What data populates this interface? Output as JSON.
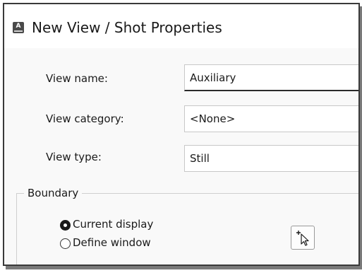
{
  "window": {
    "title": "New View / Shot Properties",
    "app_icon_letter": "A",
    "app_icon": "autocad-app-icon"
  },
  "form": {
    "view_name_label": "View name:",
    "view_name_value": "Auxiliary",
    "view_category_label": "View category:",
    "view_category_value": "<None>",
    "view_type_label": "View type:",
    "view_type_value": "Still"
  },
  "boundary": {
    "legend": "Boundary",
    "options": [
      {
        "label": "Current display",
        "selected": true
      },
      {
        "label": "Define window",
        "selected": false
      }
    ],
    "pick_button_icon": "select-window-cursor-icon"
  },
  "colors": {
    "dialog_bg": "#f9f9f9",
    "titlebar_bg": "#ffffff",
    "text": "#1a1a1a",
    "field_border": "#c8c8c8",
    "active_underline": "#2b2b2b"
  }
}
